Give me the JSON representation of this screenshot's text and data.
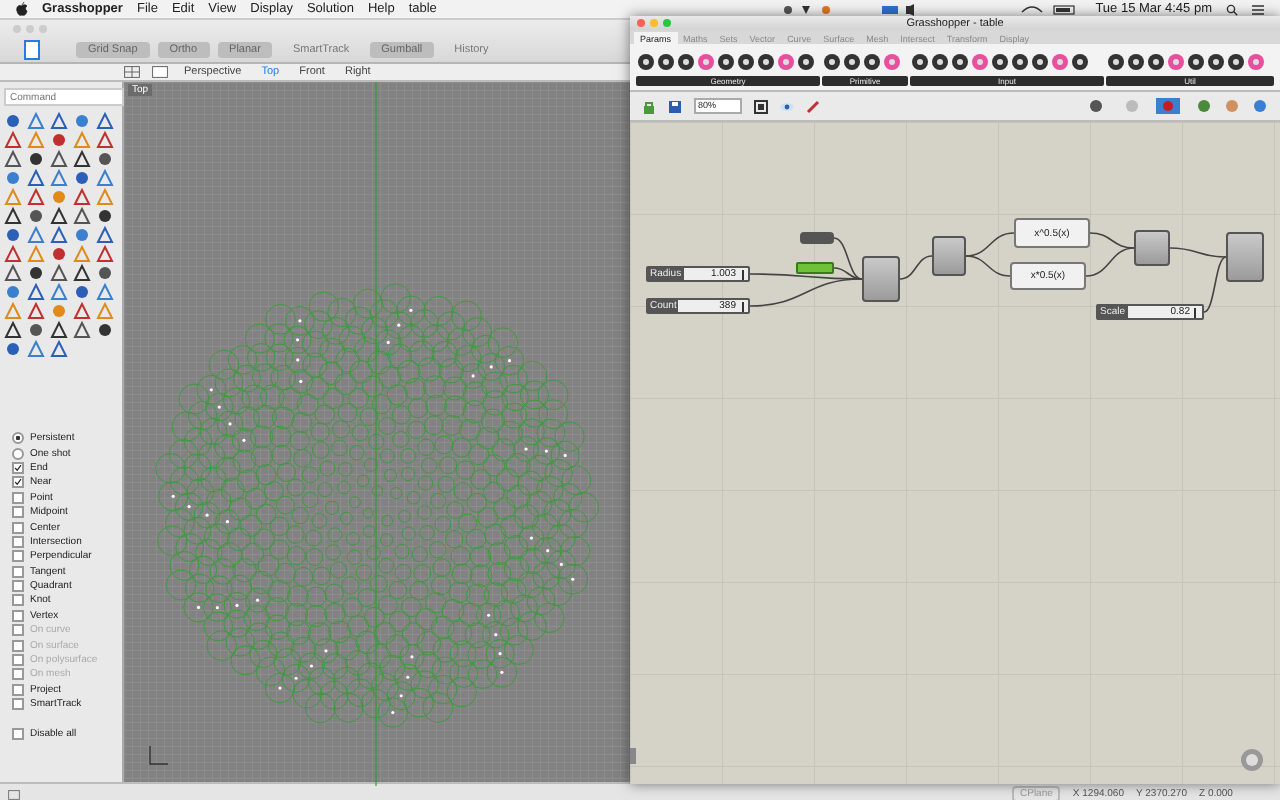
{
  "menu_bar": {
    "menus": [
      "Grasshopper",
      "File",
      "Edit",
      "View",
      "Display",
      "Solution",
      "Help",
      "table"
    ],
    "clock": "Tue 15 Mar 4:45 pm"
  },
  "rhino": {
    "toggles": [
      {
        "label": "Grid Snap",
        "on": true
      },
      {
        "label": "Ortho",
        "on": true
      },
      {
        "label": "Planar",
        "on": true
      },
      {
        "label": "SmartTrack",
        "on": false
      },
      {
        "label": "Gumball",
        "on": true
      },
      {
        "label": "History",
        "on": false
      }
    ],
    "viewport_tabs": [
      {
        "label": "Perspective",
        "selected": false
      },
      {
        "label": "Top",
        "selected": true
      },
      {
        "label": "Front",
        "selected": false
      },
      {
        "label": "Right",
        "selected": false
      }
    ],
    "viewport": {
      "title": "Top"
    },
    "command": {
      "placeholder": "Command"
    },
    "osnaps": [
      {
        "kind": "radio",
        "label": "Persistent",
        "checked": true,
        "disabled": false
      },
      {
        "kind": "radio",
        "label": "One shot",
        "checked": false,
        "disabled": false
      },
      {
        "kind": "check",
        "label": "End",
        "checked": true,
        "disabled": false
      },
      {
        "kind": "check",
        "label": "Near",
        "checked": true,
        "disabled": false
      },
      {
        "kind": "check",
        "label": "Point",
        "checked": false,
        "disabled": false
      },
      {
        "kind": "check",
        "label": "Midpoint",
        "checked": false,
        "disabled": false
      },
      {
        "kind": "check",
        "label": "Center",
        "checked": false,
        "disabled": false
      },
      {
        "kind": "check",
        "label": "Intersection",
        "checked": false,
        "disabled": false
      },
      {
        "kind": "check",
        "label": "Perpendicular",
        "checked": false,
        "disabled": false
      },
      {
        "kind": "check",
        "label": "Tangent",
        "checked": false,
        "disabled": false
      },
      {
        "kind": "check",
        "label": "Quadrant",
        "checked": false,
        "disabled": false
      },
      {
        "kind": "check",
        "label": "Knot",
        "checked": false,
        "disabled": false
      },
      {
        "kind": "check",
        "label": "Vertex",
        "checked": false,
        "disabled": false
      },
      {
        "kind": "check",
        "label": "On curve",
        "checked": false,
        "disabled": true
      },
      {
        "kind": "check",
        "label": "On surface",
        "checked": false,
        "disabled": true
      },
      {
        "kind": "check",
        "label": "On polysurface",
        "checked": false,
        "disabled": true
      },
      {
        "kind": "check",
        "label": "On mesh",
        "checked": false,
        "disabled": true
      },
      {
        "kind": "check",
        "label": "Project",
        "checked": false,
        "disabled": false
      },
      {
        "kind": "check",
        "label": "SmartTrack",
        "checked": false,
        "disabled": false
      },
      {
        "kind": "spacer"
      },
      {
        "kind": "check",
        "label": "Disable all",
        "checked": false,
        "disabled": false
      }
    ],
    "status": {
      "cplane": "CPlane",
      "x": "X 1294.060",
      "y": "Y 2370.270",
      "z": "Z 0.000"
    }
  },
  "grasshopper": {
    "title": "Grasshopper - table",
    "tabs": [
      {
        "label": "Params",
        "selected": true
      },
      {
        "label": "Maths",
        "selected": false
      },
      {
        "label": "Sets",
        "selected": false
      },
      {
        "label": "Vector",
        "selected": false
      },
      {
        "label": "Curve",
        "selected": false
      },
      {
        "label": "Surface",
        "selected": false
      },
      {
        "label": "Mesh",
        "selected": false
      },
      {
        "label": "Intersect",
        "selected": false
      },
      {
        "label": "Transform",
        "selected": false
      },
      {
        "label": "Display",
        "selected": false
      }
    ],
    "groups": [
      "Geometry",
      "Primitive",
      "Input",
      "Util"
    ],
    "zoom": "80%",
    "nodes": [
      {
        "kind": "slider",
        "label": "Radius",
        "value": "1.003",
        "level": 0.95
      },
      {
        "kind": "slider",
        "label": "Count",
        "value": "389",
        "level": 0.95
      },
      {
        "kind": "slider",
        "label": "Scale",
        "value": "0.82",
        "level": 0.92
      },
      {
        "kind": "param"
      },
      {
        "kind": "toggle"
      },
      {
        "kind": "component"
      },
      {
        "kind": "component"
      },
      {
        "kind": "expression",
        "label": "x^0.5(x)"
      },
      {
        "kind": "expression",
        "label": "x*0.5(x)"
      },
      {
        "kind": "component"
      },
      {
        "kind": "component"
      }
    ]
  }
}
